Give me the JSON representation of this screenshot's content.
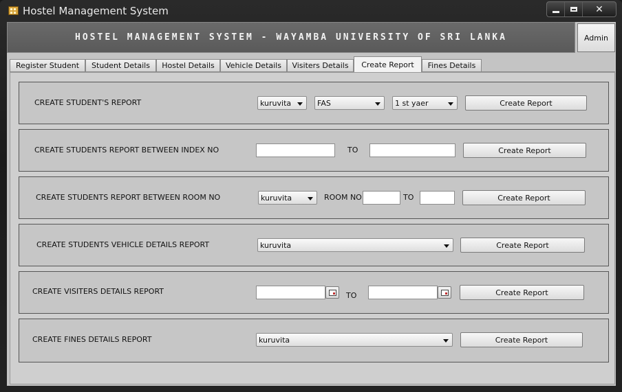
{
  "window": {
    "title": "Hostel Management System",
    "controls": {
      "minimize": "minimize",
      "maximize": "maximize",
      "close": "✕"
    }
  },
  "header": {
    "banner": "HOSTEL MANAGEMENT SYSTEM - WAYAMBA UNIVERSITY OF SRI LANKA",
    "admin_button": "Admin"
  },
  "tabs": [
    {
      "label": "Register Student",
      "active": false
    },
    {
      "label": "Student Details",
      "active": false
    },
    {
      "label": "Hostel Details",
      "active": false
    },
    {
      "label": "Vehicle Details",
      "active": false
    },
    {
      "label": "Visiters Details",
      "active": false
    },
    {
      "label": "Create Report",
      "active": true
    },
    {
      "label": "Fines Details",
      "active": false
    }
  ],
  "panels": {
    "students": {
      "label": "CREATE STUDENT'S REPORT",
      "hostel": "kuruvita",
      "faculty": "FAS",
      "year": "1 st yaer",
      "button": "Create Report"
    },
    "index": {
      "label": "CREATE STUDENTS REPORT BETWEEN INDEX NO",
      "from": "",
      "to_label": "TO",
      "to": "",
      "button": "Create Report"
    },
    "room": {
      "label": "CREATE STUDENTS REPORT BETWEEN ROOM NO",
      "hostel": "kuruvita",
      "room_label": "ROOM NO",
      "from": "",
      "to_label": "TO",
      "to": "",
      "button": "Create Report"
    },
    "vehicle": {
      "label": "CREATE STUDENTS VEHICLE DETAILS REPORT",
      "hostel": "kuruvita",
      "button": "Create Report"
    },
    "visiters": {
      "label": "CREATE VISITERS DETAILS REPORT",
      "from_date": "",
      "to_label": "TO",
      "to_date": "",
      "button": "Create Report"
    },
    "fines": {
      "label": "CREATE FINES DETAILS REPORT",
      "hostel": "kuruvita",
      "button": "Create Report"
    }
  }
}
